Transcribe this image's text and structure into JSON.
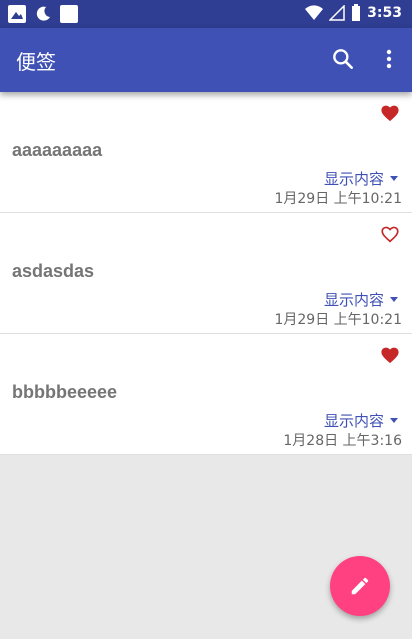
{
  "status_bar": {
    "time": "3:53"
  },
  "app_bar": {
    "title": "便签"
  },
  "notes": [
    {
      "title": "aaaaaaaaa",
      "show_label": "显示内容",
      "date": "1月29日 上午10:21",
      "favorited": true
    },
    {
      "title": "asdasdas",
      "show_label": "显示内容",
      "date": "1月29日 上午10:21",
      "favorited": false
    },
    {
      "title": "bbbbbeeeee",
      "show_label": "显示内容",
      "date": "1月28日 上午3:16",
      "favorited": true
    }
  ],
  "colors": {
    "primary": "#3f51b5",
    "primary_dark": "#2f3d92",
    "accent": "#ff4081",
    "heart": "#c62828"
  },
  "icons": {
    "search": "search-icon",
    "more": "more-vert-icon",
    "favorite": "heart-filled-icon",
    "not_favorite": "heart-outline-icon",
    "fab": "pencil-icon"
  }
}
